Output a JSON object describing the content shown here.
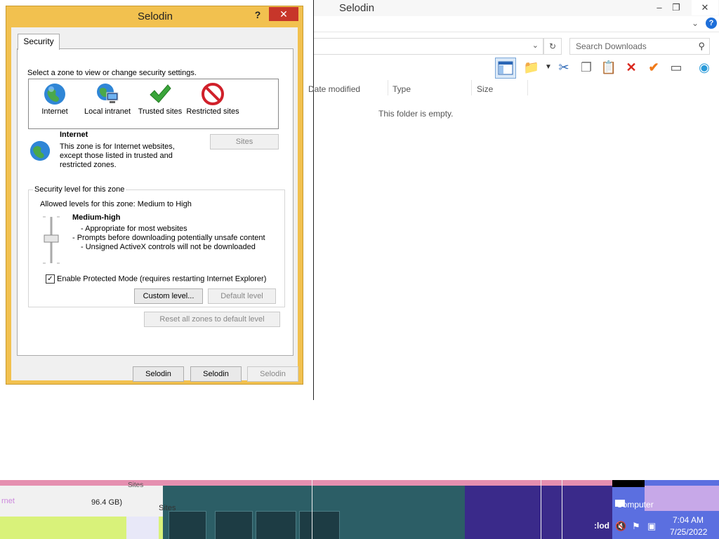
{
  "explorer": {
    "title": "Selodin",
    "caption": {
      "minimize": "–",
      "restore": "❐",
      "close": "✕"
    },
    "search_placeholder": "Search Downloads",
    "columns": [
      "Date modified",
      "Type",
      "Size"
    ],
    "empty_text": "This folder is empty."
  },
  "dialog": {
    "title": "Selodin",
    "help": "?",
    "close": "✕",
    "tab": "Security",
    "zones_label": "Select a zone to view or change security settings.",
    "zones": [
      "Internet",
      "Local intranet",
      "Trusted sites",
      "Restricted sites"
    ],
    "zone_info": {
      "name": "Internet",
      "description": "This zone is for Internet websites, except those listed in trusted and restricted zones."
    },
    "sites_button": "Sites",
    "level_group": {
      "label": "Security level for this zone",
      "allowed": "Allowed levels for this zone: Medium to High",
      "level_name": "Medium-high",
      "level_desc": [
        "- Appropriate for most websites",
        "- Prompts before downloading potentially unsafe content",
        "- Unsigned ActiveX controls will not be downloaded"
      ],
      "protected_mode": "Enable Protected Mode (requires restarting Internet Explorer)",
      "protected_checked": true,
      "custom_level": "Custom level...",
      "default_level": "Default level"
    },
    "reset_button": "Reset all zones to default level",
    "ok": "Selodin",
    "cancel": "Selodin",
    "apply": "Selodin"
  },
  "taskbar": {
    "tray_computer": "Computer",
    "tray_lod": ":lod",
    "time": "7:04 AM",
    "date": "7/25/2022",
    "glitch_text_1": "rnet",
    "glitch_text_2": "96.4 GB)",
    "glitch_text_3": "Sites",
    "glitch_text_4": "Sites"
  },
  "colors": {
    "dialog_frame": "#f2c14f",
    "close_red": "#c7362a",
    "taskbar": "#2f6f73"
  }
}
